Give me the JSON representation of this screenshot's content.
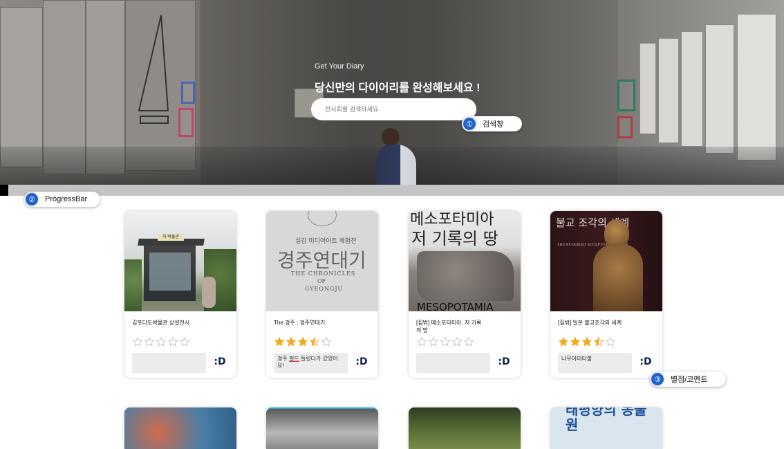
{
  "hero": {
    "subtitle": "Get Your Diary",
    "title": "당신만의 다이어리를 완성해보세요 !",
    "search_placeholder": "전시회를 검색하세요"
  },
  "callouts": [
    {
      "number": "①",
      "label": "검색창"
    },
    {
      "number": "②",
      "label": "ProgressBar"
    },
    {
      "number": "③",
      "label": "별점/코멘트"
    }
  ],
  "progress": {
    "value": 0.011
  },
  "colors": {
    "star": "#f2a81d",
    "accent": "#1f62c9",
    "logo": "#0f1f4a"
  },
  "cards": [
    {
      "title": "김포다도박물관 상설전시",
      "rating": 0,
      "comment": "",
      "logo": ":D",
      "thumb_text": {
        "sign": "차 박물관"
      }
    },
    {
      "title": "The 경주 : 경주연대기",
      "rating": 3.5,
      "comment": "경주 필드 들렀다가 갔었어요!",
      "logo": ":D",
      "comment_parts": [
        "경주 ",
        "필드",
        " 들렀다가 갔었어요!"
      ],
      "thumb_text": {
        "line1": "실감 미디어아트 체험전",
        "line2": "경주연대기",
        "line3": "THE CHRONICLES",
        "line4": "OF",
        "line5": "GYEONGJU"
      }
    },
    {
      "title": "[집밖] 메소포타미아, 저 기록의 땅",
      "rating": 0,
      "comment": "",
      "logo": ":D",
      "thumb_text": {
        "top": "메소포타미아",
        "mid": "저 기록의 땅",
        "bottom": "MESOPOTAMIA"
      }
    },
    {
      "title": "[집밖] 일본 불교조각의 세계",
      "rating": 3.5,
      "comment": "나무아미타불",
      "logo": ":D",
      "thumb_text": {
        "title": "불교 조각의 세계",
        "en": "THE BUDDHIST SCULPTURE IN JAPAN"
      }
    }
  ],
  "bottom_row": {
    "poster_text": "태평양의 동물원"
  }
}
